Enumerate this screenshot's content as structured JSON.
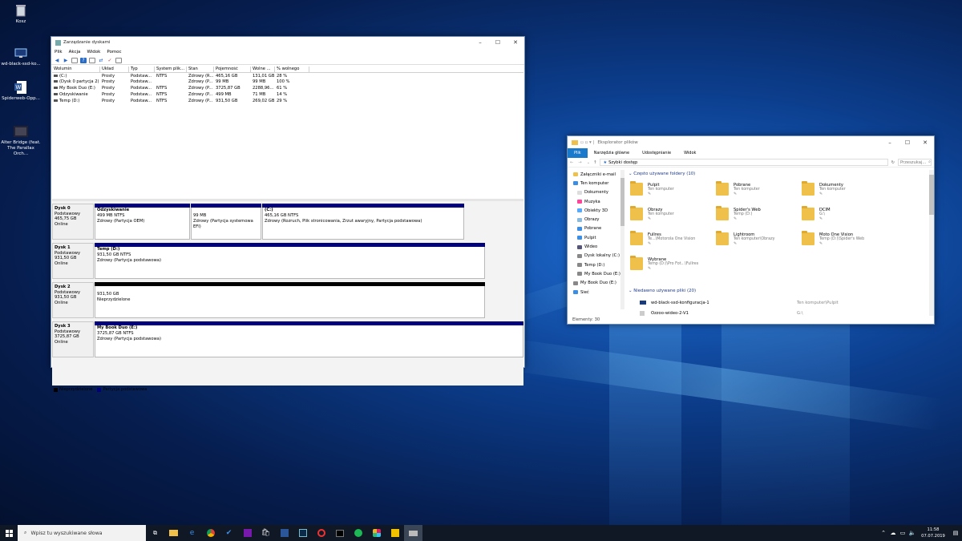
{
  "desktop": {
    "icons": [
      {
        "label": "Kosz",
        "icon": "recycle-bin-icon"
      },
      {
        "label": "wd-black-ssd-ko...",
        "icon": "monitor-icon"
      },
      {
        "label": "Spiderweb-Opp...",
        "icon": "word-document-icon"
      },
      {
        "label": "Alter Bridge (feat. The Parallax Orch...",
        "icon": "video-thumbnail-icon"
      }
    ]
  },
  "disk_management": {
    "title": "Zarządzanie dyskami",
    "menu": [
      "Plik",
      "Akcja",
      "Widok",
      "Pomoc"
    ],
    "columns": [
      "Wolumin",
      "Układ",
      "Typ",
      "System plik...",
      "Stan",
      "Pojemność",
      "Wolne ...",
      "% wolnego"
    ],
    "rows": [
      [
        "(C:)",
        "Prosty",
        "Podstaw...",
        "NTFS",
        "Zdrowy (R...",
        "465,16 GB",
        "131,01 GB",
        "28 %"
      ],
      [
        "(Dysk 0 partycja 2)",
        "Prosty",
        "Podstaw...",
        "",
        "Zdrowy (P...",
        "99 MB",
        "99 MB",
        "100 %"
      ],
      [
        "My Book Duo (E:)",
        "Prosty",
        "Podstaw...",
        "NTFS",
        "Zdrowy (P...",
        "3725,87 GB",
        "2288,96...",
        "61 %"
      ],
      [
        "Odzyskiwanie",
        "Prosty",
        "Podstaw...",
        "NTFS",
        "Zdrowy (P...",
        "499 MB",
        "71 MB",
        "14 %"
      ],
      [
        "Temp (D:)",
        "Prosty",
        "Podstaw...",
        "NTFS",
        "Zdrowy (P...",
        "931,50 GB",
        "269,02 GB",
        "29 %"
      ]
    ],
    "disks": [
      {
        "name": "Dysk 0",
        "type": "Podstawowy",
        "size": "465,75 GB",
        "status": "Online",
        "parts": [
          {
            "name": "Odzyskiwanie",
            "size": "499 MB NTFS",
            "status": "Zdrowy (Partycja OEM)",
            "kind": "primary"
          },
          {
            "name": "",
            "size": "99 MB",
            "status": "Zdrowy (Partycja systemowa EFI)",
            "kind": "primary"
          },
          {
            "name": "(C:)",
            "size": "465,16 GB NTFS",
            "status": "Zdrowy (Rozruch, Plik stronicowania, Zrzut awaryjny, Partycja podstawowa)",
            "kind": "primary"
          }
        ]
      },
      {
        "name": "Dysk 1",
        "type": "Podstawowy",
        "size": "931,50 GB",
        "status": "Online",
        "parts": [
          {
            "name": "Temp  (D:)",
            "size": "931,50 GB NTFS",
            "status": "Zdrowy (Partycja podstawowa)",
            "kind": "primary"
          }
        ]
      },
      {
        "name": "Dysk 2",
        "type": "Podstawowy",
        "size": "931,50 GB",
        "status": "Online",
        "parts": [
          {
            "name": "",
            "size": "931,50 GB",
            "status": "Nieprzydzielone",
            "kind": "unallocated"
          }
        ]
      },
      {
        "name": "Dysk 3",
        "type": "Podstawowy",
        "size": "3725,87 GB",
        "status": "Online",
        "parts": [
          {
            "name": "My Book Duo  (E:)",
            "size": "3725,87 GB NTFS",
            "status": "Zdrowy (Partycja podstawowa)",
            "kind": "primary"
          }
        ]
      }
    ],
    "legend": {
      "unallocated": "Nieprzydzielone",
      "primary": "Partycja podstawowa",
      "unallocated_color": "#000000",
      "primary_color": "#00007a"
    }
  },
  "explorer": {
    "title": "Eksplorator plików",
    "ribbon": [
      "Plik",
      "Narzędzia główne",
      "Udostępnianie",
      "Widok"
    ],
    "address": "Szybki dostęp",
    "search_placeholder": "Przeszukaj...",
    "nav": [
      "Załączniki e-mail",
      "Ten komputer",
      "Dokumenty",
      "Muzyka",
      "Obiekty 3D",
      "Obrazy",
      "Pobrane",
      "Pulpit",
      "Wideo",
      "Dysk lokalny (C:)",
      "Temp (D:)",
      "My Book Duo (E:)",
      "My Book Duo (E:)",
      "Sieć"
    ],
    "frequent_header": "Często używane foldery (10)",
    "folders": [
      {
        "name": "Pulpit",
        "sub": "Ten komputer"
      },
      {
        "name": "Pobrane",
        "sub": "Ten komputer"
      },
      {
        "name": "Dokumenty",
        "sub": "Ten komputer"
      },
      {
        "name": "Obrazy",
        "sub": "Ten komputer"
      },
      {
        "name": "Spider's Web",
        "sub": "Temp (D:)"
      },
      {
        "name": "DCIM",
        "sub": "G:\\"
      },
      {
        "name": "Fullres",
        "sub": "Te...\\Motorola One Vision"
      },
      {
        "name": "Lightroom",
        "sub": "Ten komputer\\Obrazy"
      },
      {
        "name": "Moto One Vision",
        "sub": "Temp (D:)\\Spider's Web"
      },
      {
        "name": "Wybrane",
        "sub": "Temp (D:)\\Pro Fot...\\Fullres"
      }
    ],
    "recent_header": "Niedawno używane pliki (20)",
    "recent": [
      {
        "name": "wd-black-ssd-konfiguracja-1",
        "path": "Ten komputer\\Pulpit"
      },
      {
        "name": "Ozzoo-wideo-2-V1",
        "path": "G:\\"
      }
    ],
    "status": "Elementy: 30"
  },
  "taskbar": {
    "search_placeholder": "Wpisz tu wyszukiwane słowa",
    "time": "11:58",
    "date": "07.07.2019"
  }
}
